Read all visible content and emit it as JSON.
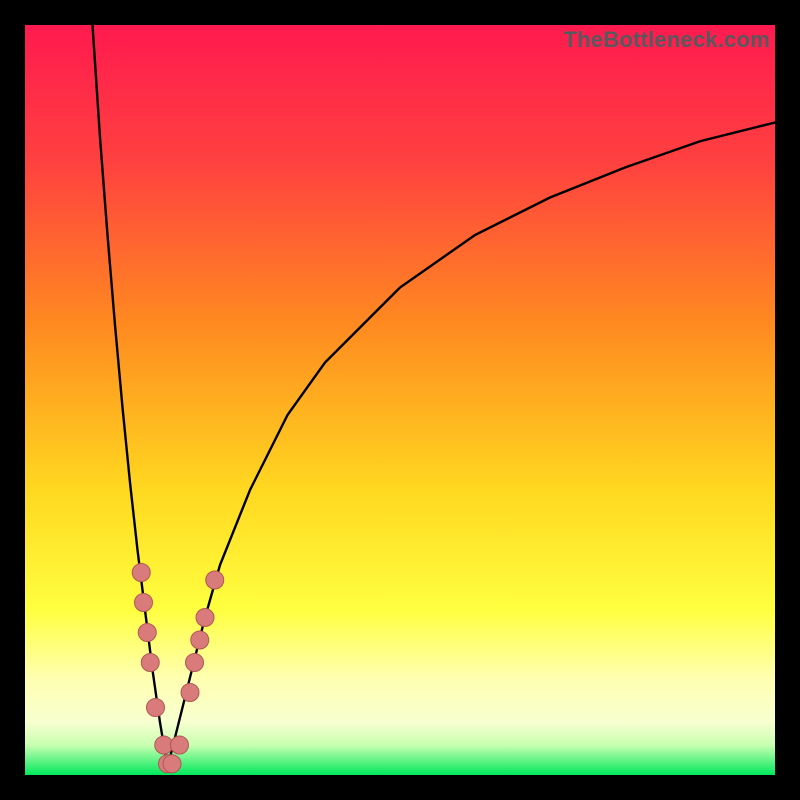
{
  "watermark": "TheBottleneck.com",
  "colors": {
    "frame_bg": "#000000",
    "grad_top": "#ff1a4f",
    "grad_mid1": "#ff5a2e",
    "grad_mid2": "#ffb020",
    "grad_mid3": "#ffe83a",
    "grad_pale": "#ffffb0",
    "grad_green": "#00e85c",
    "curve_stroke": "#000000",
    "marker_fill": "#d97b7b",
    "marker_edge": "#b05656"
  },
  "chart_data": {
    "type": "line",
    "title": "",
    "xlabel": "",
    "ylabel": "",
    "xlim": [
      0,
      100
    ],
    "ylim": [
      0,
      100
    ],
    "description": "Bottleneck V-curve: steep descent from top-left to a minimum near x≈19 at y≈0, then an increasingly shallow asymptotic rise toward the upper right (~y≈87 at x=100). Pink dot markers cluster on both flanks of the trough roughly between y≈2 and y≈27.",
    "series": [
      {
        "name": "left-branch",
        "x": [
          9,
          10,
          11,
          12,
          13,
          14,
          15,
          16,
          17,
          18,
          19
        ],
        "y": [
          100,
          85,
          72,
          60,
          49,
          39,
          30,
          22,
          14,
          7,
          1
        ]
      },
      {
        "name": "right-branch",
        "x": [
          19,
          20,
          22,
          24,
          26,
          30,
          35,
          40,
          50,
          60,
          70,
          80,
          90,
          100
        ],
        "y": [
          1,
          5,
          13,
          21,
          28,
          38,
          48,
          55,
          65,
          72,
          77,
          81,
          84.5,
          87
        ]
      }
    ],
    "markers": {
      "left": [
        {
          "x": 15.5,
          "y": 27
        },
        {
          "x": 15.8,
          "y": 23
        },
        {
          "x": 16.3,
          "y": 19
        },
        {
          "x": 16.7,
          "y": 15
        },
        {
          "x": 17.4,
          "y": 9
        },
        {
          "x": 18.5,
          "y": 4
        },
        {
          "x": 19.0,
          "y": 1.5
        }
      ],
      "right": [
        {
          "x": 19.6,
          "y": 1.5
        },
        {
          "x": 20.6,
          "y": 4
        },
        {
          "x": 22.0,
          "y": 11
        },
        {
          "x": 22.6,
          "y": 15
        },
        {
          "x": 23.3,
          "y": 18
        },
        {
          "x": 24.0,
          "y": 21
        },
        {
          "x": 25.3,
          "y": 26
        }
      ]
    }
  }
}
